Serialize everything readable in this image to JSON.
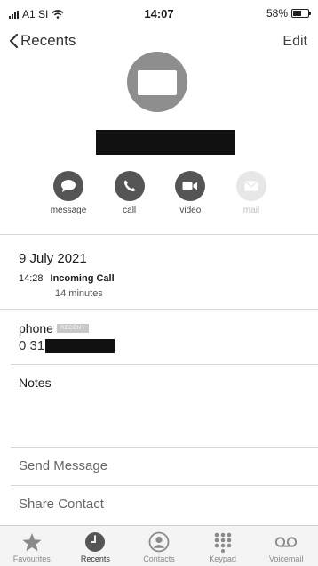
{
  "status_bar": {
    "carrier": "A1 SI",
    "time": "14:07",
    "battery": "58%",
    "battery_level": 0.58
  },
  "nav": {
    "back_label": "Recents",
    "edit_label": "Edit"
  },
  "actions": [
    {
      "label": "message",
      "icon": "message-icon",
      "enabled": true
    },
    {
      "label": "call",
      "icon": "phone-icon",
      "enabled": true
    },
    {
      "label": "video",
      "icon": "video-icon",
      "enabled": true
    },
    {
      "label": "mail",
      "icon": "mail-icon",
      "enabled": false
    }
  ],
  "call_log": {
    "date": "9 July 2021",
    "time": "14:28",
    "type": "Incoming Call",
    "duration": "14 minutes"
  },
  "phone": {
    "label": "phone",
    "badge": "RECENT",
    "number_prefix": "0 31"
  },
  "notes_label": "Notes",
  "rows": {
    "send_message": "Send Message",
    "share_contact": "Share Contact"
  },
  "tabs": [
    {
      "label": "Favourites",
      "icon": "star-icon",
      "active": false
    },
    {
      "label": "Recents",
      "icon": "clock-icon",
      "active": true
    },
    {
      "label": "Contacts",
      "icon": "contact-icon",
      "active": false
    },
    {
      "label": "Keypad",
      "icon": "keypad-icon",
      "active": false
    },
    {
      "label": "Voicemail",
      "icon": "voicemail-icon",
      "active": false
    }
  ],
  "colors": {
    "icon_gray": "#555555",
    "disabled_gray": "#e7e7e7",
    "tab_bar_bg": "#f4f4f4"
  }
}
